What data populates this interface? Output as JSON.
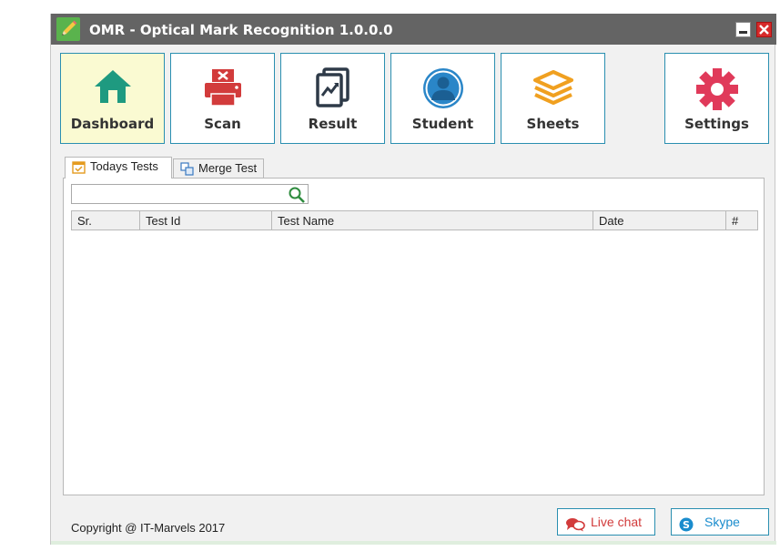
{
  "window": {
    "title": "OMR - Optical Mark Recognition 1.0.0.0"
  },
  "nav": [
    {
      "label": "Dashboard",
      "icon": "home-icon",
      "color": "#1e9a80",
      "active": true
    },
    {
      "label": "Scan",
      "icon": "scanner-icon",
      "color": "#d23b3b"
    },
    {
      "label": "Result",
      "icon": "result-chart-icon",
      "color": "#2e3a48"
    },
    {
      "label": "Student",
      "icon": "user-avatar-icon",
      "color": "#2a86c8"
    },
    {
      "label": "Sheets",
      "icon": "layers-icon",
      "color": "#f0a020"
    },
    {
      "label": "Settings",
      "icon": "gear-icon",
      "color": "#e03a5a"
    }
  ],
  "tabs": [
    {
      "label": "Todays Tests",
      "icon": "calendar-check-icon",
      "selected": true
    },
    {
      "label": "Merge Test",
      "icon": "merge-icon",
      "selected": false
    }
  ],
  "search": {
    "value": "",
    "placeholder": ""
  },
  "grid": {
    "columns": [
      "Sr.",
      "Test Id",
      "Test Name",
      "Date",
      "#"
    ]
  },
  "footer": {
    "copyright": "Copyright @ IT-Marvels 2017",
    "live_chat": "Live chat",
    "skype": "Skype"
  }
}
